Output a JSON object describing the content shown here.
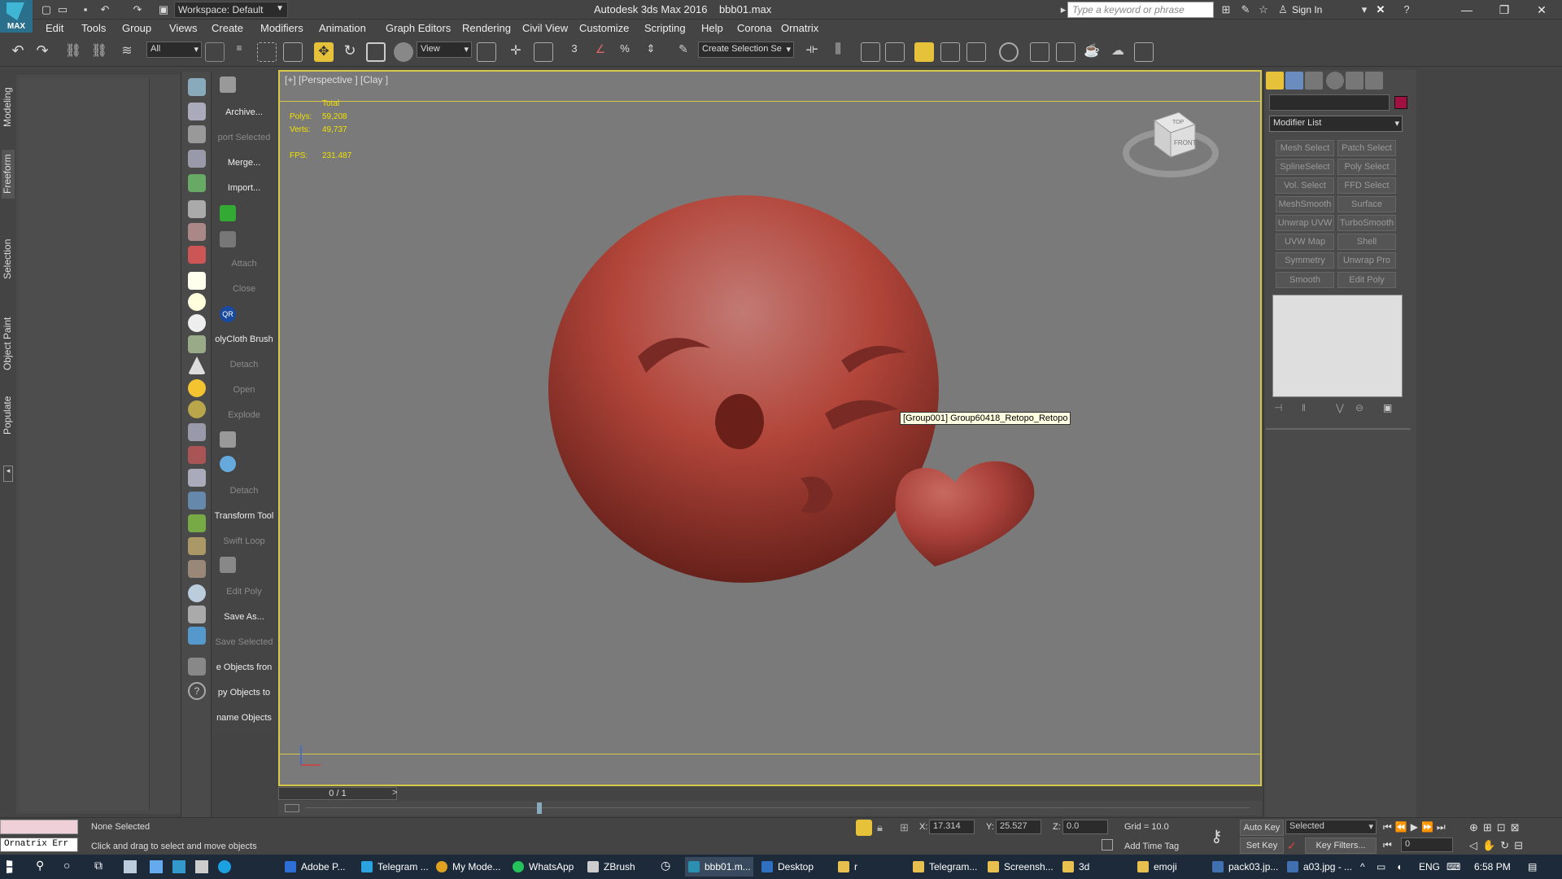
{
  "title_bar": {
    "logo_text": "MAX",
    "workspace": "Workspace: Default",
    "app_title": "Autodesk 3ds Max 2016",
    "file_name": "bbb01.max",
    "search_placeholder": "Type a keyword or phrase",
    "sign_in": "Sign In"
  },
  "menu": [
    "Edit",
    "Tools",
    "Group",
    "Views",
    "Create",
    "Modifiers",
    "Animation",
    "Graph Editors",
    "Rendering",
    "Civil View",
    "Customize",
    "Scripting",
    "Help",
    "Corona",
    "Ornatrix"
  ],
  "toolbar": {
    "selection_filter": "All",
    "ref_coord": "View",
    "snap_label": "3",
    "named_selection_placeholder": "Create Selection Se"
  },
  "ribbon_tabs": [
    "Modeling",
    "Freeform",
    "Selection",
    "Object Paint",
    "Populate"
  ],
  "tool_labels": [
    {
      "text": "Archive...",
      "dim": false
    },
    {
      "text": "port Selected",
      "dim": true
    },
    {
      "text": "Merge...",
      "dim": false
    },
    {
      "text": "Import...",
      "dim": false
    },
    {
      "text": "Attach",
      "dim": true
    },
    {
      "text": "Close",
      "dim": true
    },
    {
      "text": "olyCloth Brush",
      "dim": false
    },
    {
      "text": "Detach",
      "dim": true
    },
    {
      "text": "Open",
      "dim": true
    },
    {
      "text": "Explode",
      "dim": true
    },
    {
      "text": "Detach",
      "dim": true
    },
    {
      "text": "Transform Tool",
      "dim": false
    },
    {
      "text": "Swift Loop",
      "dim": true
    },
    {
      "text": "Edit Poly",
      "dim": true
    },
    {
      "text": "Save As...",
      "dim": false
    },
    {
      "text": "Save Selected",
      "dim": true
    },
    {
      "text": "e Objects fron",
      "dim": false
    },
    {
      "text": "py Objects to",
      "dim": false
    },
    {
      "text": "name Objects",
      "dim": false
    }
  ],
  "viewport": {
    "label": "[+] [Perspective ] [Clay ]",
    "stats_header": "Total",
    "polys_label": "Polys:",
    "polys_value": "59,208",
    "verts_label": "Verts:",
    "verts_value": "49,737",
    "fps_label": "FPS:",
    "fps_value": "231.487",
    "tooltip": "[Group001] Group60418_Retopo_Retopo",
    "viewcube_top": "TOP",
    "viewcube_front": "FRONT",
    "object_color": "#b2453a"
  },
  "timeline": {
    "frame": "0 / 1"
  },
  "command_panel": {
    "modifier_list": "Modifier List",
    "modifiers": [
      [
        "Mesh Select",
        "Patch Select"
      ],
      [
        "SplineSelect",
        "Poly Select"
      ],
      [
        "Vol. Select",
        "FFD Select"
      ],
      [
        "MeshSmooth",
        "Surface Select"
      ],
      [
        "Unwrap UVW",
        "TurboSmooth"
      ],
      [
        "UVW Map",
        "Shell"
      ],
      [
        "Symmetry",
        "Unwrap Pro"
      ],
      [
        "Smooth",
        "Edit Poly"
      ]
    ]
  },
  "status_bar": {
    "script_listener": "Ornatrix Err",
    "selection": "None Selected",
    "prompt": "Click and drag to select and move objects",
    "x_label": "X:",
    "x_value": "17.314",
    "y_label": "Y:",
    "y_value": "25.527",
    "z_label": "Z:",
    "z_value": "0.0",
    "grid": "Grid = 10.0",
    "add_time_tag": "Add Time Tag",
    "auto_key": "Auto Key",
    "set_key": "Set Key",
    "selected_dropdown": "Selected",
    "key_filters": "Key Filters...",
    "current_frame": "0"
  },
  "taskbar": {
    "apps": [
      {
        "label": "Adobe P...",
        "color": "#2d6fd6"
      },
      {
        "label": "Telegram ...",
        "color": "#2aa3e0"
      },
      {
        "label": "My Mode...",
        "color": "#e0a020"
      },
      {
        "label": "WhatsApp",
        "color": "#25c15a"
      },
      {
        "label": "ZBrush",
        "color": "#cccccc"
      },
      {
        "label": "bbb01.m...",
        "color": "#2a8fb0"
      },
      {
        "label": "Desktop",
        "color": "#3070c0"
      },
      {
        "label": "r",
        "color": "#e8c050"
      },
      {
        "label": "Telegram...",
        "color": "#e8c050"
      },
      {
        "label": "Screensh...",
        "color": "#e8c050"
      },
      {
        "label": "3d",
        "color": "#e8c050"
      },
      {
        "label": "emoji",
        "color": "#e8c050"
      },
      {
        "label": "pack03.jp...",
        "color": "#4070b0"
      },
      {
        "label": "a03.jpg - ...",
        "color": "#4070b0"
      }
    ],
    "lang": "ENG",
    "time": "6:58 PM"
  }
}
